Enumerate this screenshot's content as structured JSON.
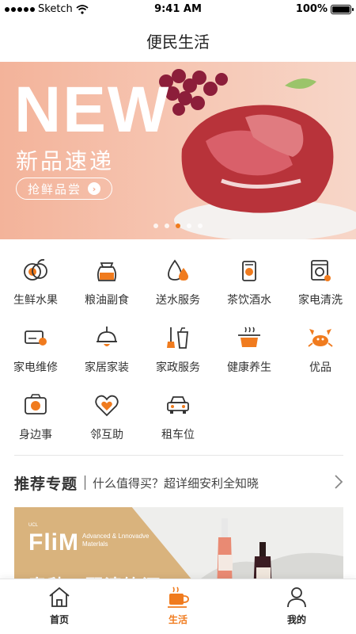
{
  "status_bar": {
    "carrier": "Sketch",
    "time": "9:41 AM",
    "battery": "100%"
  },
  "nav": {
    "title": "便民生活"
  },
  "banner": {
    "headline": "NEW",
    "subtitle": "新品速递",
    "button_label": "抢鲜品尝",
    "page_count": 5,
    "active_page": 2
  },
  "categories": [
    {
      "label": "生鲜水果",
      "icon": "fruit-icon"
    },
    {
      "label": "粮油副食",
      "icon": "rice-bag-icon"
    },
    {
      "label": "送水服务",
      "icon": "water-drop-icon"
    },
    {
      "label": "茶饮酒水",
      "icon": "drink-can-icon"
    },
    {
      "label": "家电清洗",
      "icon": "washing-machine-icon"
    },
    {
      "label": "家电维修",
      "icon": "appliance-repair-icon"
    },
    {
      "label": "家居家装",
      "icon": "ceiling-lamp-icon"
    },
    {
      "label": "家政服务",
      "icon": "cleaning-icon"
    },
    {
      "label": "健康养生",
      "icon": "cooking-pot-icon"
    },
    {
      "label": "优品",
      "icon": "crab-icon"
    },
    {
      "label": "身边事",
      "icon": "camera-icon"
    },
    {
      "label": "邻互助",
      "icon": "heart-hand-icon"
    },
    {
      "label": "租车位",
      "icon": "car-icon"
    }
  ],
  "recommend": {
    "title": "推荐专题",
    "subtitle": "什么值得买？超详细安利全知晓"
  },
  "feature": {
    "brand": "FliM",
    "brand_prefix": "UCL",
    "brand_desc": "Advanced & Lnnovadve Materlals",
    "caption": "春秋一配清饮酒"
  },
  "tabs": [
    {
      "label": "首页",
      "icon": "home-icon",
      "active": false
    },
    {
      "label": "生活",
      "icon": "coffee-cup-icon",
      "active": true
    },
    {
      "label": "我的",
      "icon": "user-icon",
      "active": false
    }
  ],
  "colors": {
    "accent": "#f07b1e",
    "banner_bg": "#f3b39a"
  }
}
